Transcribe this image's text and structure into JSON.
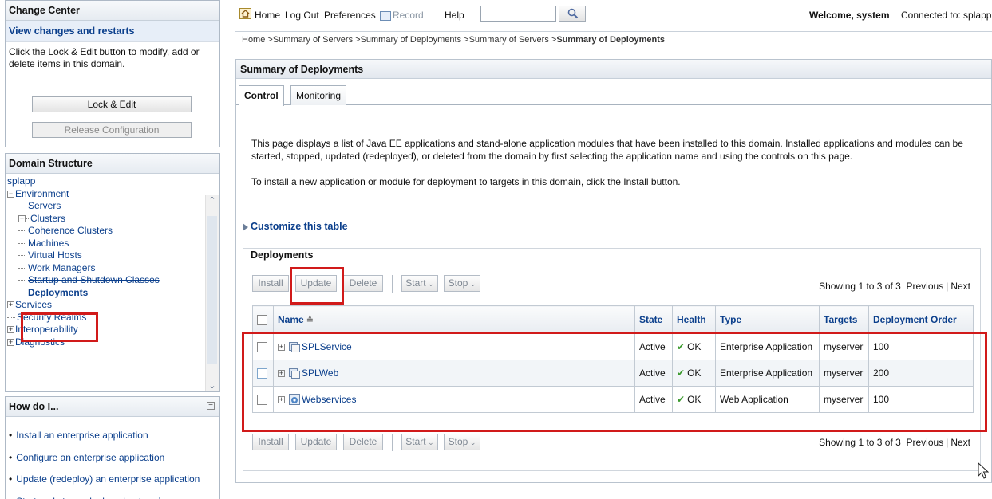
{
  "change_center": {
    "title": "Change Center",
    "link": "View changes and restarts",
    "instructions": "Click the Lock & Edit button to modify, add or delete items in this domain.",
    "lock_button": "Lock & Edit",
    "release_button": "Release Configuration"
  },
  "domain_structure": {
    "title": "Domain Structure",
    "items": [
      {
        "label": "splapp"
      },
      {
        "label": "Environment"
      },
      {
        "label": "Servers"
      },
      {
        "label": "Clusters"
      },
      {
        "label": "Coherence Clusters"
      },
      {
        "label": "Machines"
      },
      {
        "label": "Virtual Hosts"
      },
      {
        "label": "Work Managers"
      },
      {
        "label": "Startup and Shutdown Classes"
      },
      {
        "label": "Deployments"
      },
      {
        "label": "Services"
      },
      {
        "label": "Security Realms"
      },
      {
        "label": "Interoperability"
      },
      {
        "label": "Diagnostics"
      }
    ]
  },
  "how_do_i": {
    "title": "How do I...",
    "items": [
      "Install an enterprise application",
      "Configure an enterprise application",
      "Update (redeploy) an enterprise application",
      "Start and stop a deployed enterprise"
    ]
  },
  "topbar": {
    "home": "Home",
    "logout": "Log Out",
    "preferences": "Preferences",
    "record": "Record",
    "help": "Help",
    "search_value": "",
    "welcome": "Welcome, system",
    "connected": "Connected to: splapp"
  },
  "breadcrumb": {
    "trail": "Home >Summary of Servers >Summary of Deployments >Summary of Servers >",
    "current": "Summary of Deployments"
  },
  "summary": {
    "title": "Summary of Deployments",
    "tabs": [
      "Control",
      "Monitoring"
    ],
    "desc1": "This page displays a list of Java EE applications and stand-alone application modules that have been installed to this domain. Installed applications and modules can be",
    "desc2": "started, stopped, updated (redeployed), or deleted from the domain by first selecting the application name and using the controls on this page.",
    "desc3": "To install a new application or module for deployment to targets in this domain, click the Install button.",
    "customize": "Customize this table"
  },
  "deployments": {
    "title": "Deployments",
    "toolbar": {
      "install": "Install",
      "update": "Update",
      "delete": "Delete",
      "start": "Start",
      "stop": "Stop"
    },
    "showing": "Showing 1 to 3 of 3",
    "previous": "Previous",
    "next": "Next",
    "columns": [
      "Name",
      "State",
      "Health",
      "Type",
      "Targets",
      "Deployment Order"
    ],
    "rows": [
      {
        "name": "SPLService",
        "state": "Active",
        "health": "OK",
        "type": "Enterprise Application",
        "targets": "myserver",
        "order": "100"
      },
      {
        "name": "SPLWeb",
        "state": "Active",
        "health": "OK",
        "type": "Enterprise Application",
        "targets": "myserver",
        "order": "200"
      },
      {
        "name": "Webservices",
        "state": "Active",
        "health": "OK",
        "type": "Web Application",
        "targets": "myserver",
        "order": "100"
      }
    ]
  },
  "colors": {
    "link": "#0b3f8c",
    "highlight": "#d11a1a",
    "ok_check": "#3b9a2d"
  }
}
